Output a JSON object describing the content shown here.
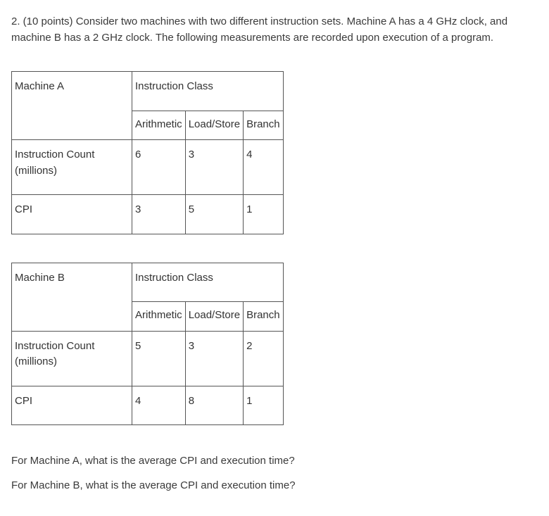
{
  "question": {
    "number_label": "2. (10 points)",
    "text": "Consider two machines with two different instruction sets. Machine A has a 4 GHz clock, and machine B has a 2 GHz clock. The following measurements are recorded upon execution of a program."
  },
  "tableA": {
    "machine_label": "Machine A",
    "instruction_class_label": "Instruction Class",
    "cols": {
      "c1": "Arithmetic",
      "c2": "Load/Store",
      "c3": "Branch"
    },
    "row1": {
      "label": "Instruction Count (millions)",
      "v1": "6",
      "v2": "3",
      "v3": "4"
    },
    "row2": {
      "label": "CPI",
      "v1": "3",
      "v2": "5",
      "v3": "1"
    }
  },
  "tableB": {
    "machine_label": "Machine B",
    "instruction_class_label": "Instruction Class",
    "cols": {
      "c1": "Arithmetic",
      "c2": "Load/Store",
      "c3": "Branch"
    },
    "row1": {
      "label": "Instruction Count (millions)",
      "v1": "5",
      "v2": "3",
      "v3": "2"
    },
    "row2": {
      "label": "CPI",
      "v1": "4",
      "v2": "8",
      "v3": "1"
    }
  },
  "footer": {
    "qA": "For Machine A, what is the average CPI and execution time?",
    "qB": "For Machine B, what is the average CPI and execution time?"
  }
}
